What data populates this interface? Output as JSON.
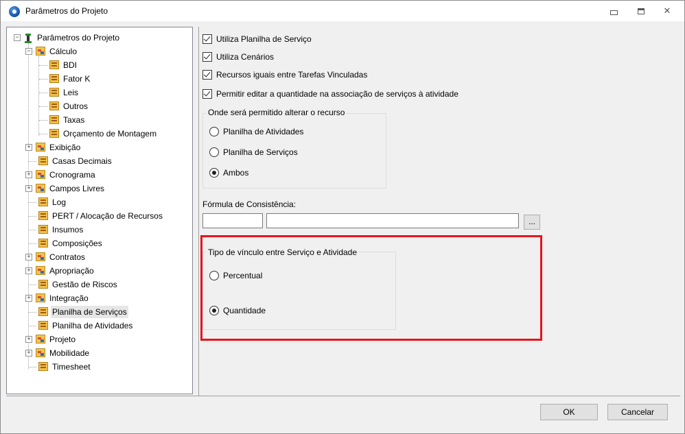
{
  "window": {
    "title": "Parâmetros do Projeto",
    "minimize": "minimize",
    "maximize": "maximize",
    "close": "✕"
  },
  "tree": {
    "root": "Parâmetros do Projeto",
    "items": [
      {
        "label": "Cálculo",
        "type": "folder",
        "expanded": true
      },
      {
        "label": "BDI",
        "type": "leaf"
      },
      {
        "label": "Fator K",
        "type": "leaf"
      },
      {
        "label": "Leis",
        "type": "leaf"
      },
      {
        "label": "Outros",
        "type": "leaf"
      },
      {
        "label": "Taxas",
        "type": "leaf"
      },
      {
        "label": "Orçamento de Montagem",
        "type": "leaf"
      },
      {
        "label": "Exibição",
        "type": "folder"
      },
      {
        "label": "Casas Decimais",
        "type": "leaf"
      },
      {
        "label": "Cronograma",
        "type": "folder"
      },
      {
        "label": "Campos Livres",
        "type": "folder"
      },
      {
        "label": "Log",
        "type": "leaf"
      },
      {
        "label": "PERT / Alocação de Recursos",
        "type": "leaf"
      },
      {
        "label": "Insumos",
        "type": "leaf"
      },
      {
        "label": "Composições",
        "type": "leaf"
      },
      {
        "label": "Contratos",
        "type": "folder"
      },
      {
        "label": "Apropriação",
        "type": "folder"
      },
      {
        "label": "Gestão de Riscos",
        "type": "leaf"
      },
      {
        "label": "Integração",
        "type": "folder"
      },
      {
        "label": "Planilha de Serviços",
        "type": "leaf",
        "selected": true
      },
      {
        "label": "Planilha de Atividades",
        "type": "leaf"
      },
      {
        "label": "Projeto",
        "type": "folder"
      },
      {
        "label": "Mobilidade",
        "type": "folder"
      },
      {
        "label": "Timesheet",
        "type": "leaf"
      }
    ]
  },
  "options": {
    "checkboxes": [
      {
        "label": "Utiliza Planilha de Serviço",
        "checked": true
      },
      {
        "label": "Utiliza Cenários",
        "checked": true
      },
      {
        "label": "Recursos iguais entre Tarefas Vinculadas",
        "checked": true
      },
      {
        "label": "Permitir editar a quantidade na associação de serviços à atividade",
        "checked": true
      }
    ],
    "resource_group": {
      "title": "Onde será permitido alterar o recurso",
      "options": [
        {
          "label": "Planilha de Atividades",
          "selected": false
        },
        {
          "label": "Planilha de Serviços",
          "selected": false
        },
        {
          "label": "Ambos",
          "selected": true
        }
      ]
    },
    "formula": {
      "label": "Fórmula de Consistência:",
      "code_value": "",
      "expr_value": "",
      "browse_label": "..."
    },
    "link_group": {
      "title": "Tipo de vínculo entre Serviço e Atividade",
      "options": [
        {
          "label": "Percentual",
          "selected": false
        },
        {
          "label": "Quantidade",
          "selected": true
        }
      ]
    }
  },
  "footer": {
    "ok": "OK",
    "cancel": "Cancelar"
  },
  "colors": {
    "highlight": "#e8131c",
    "background": "#f0f0f0"
  }
}
